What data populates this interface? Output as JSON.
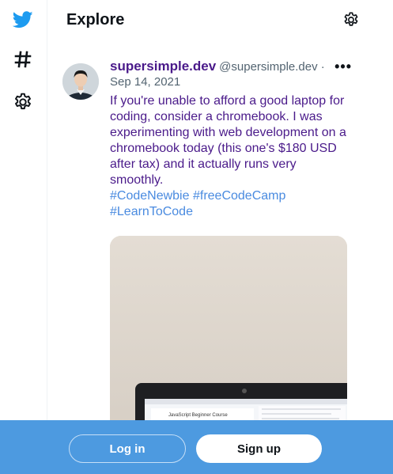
{
  "page": {
    "title": "Explore"
  },
  "nav": {
    "icons": [
      "twitter-logo-icon",
      "hashtag-icon",
      "gear-icon"
    ]
  },
  "tweet": {
    "author": "supersimple.dev",
    "handle": "@supersimple.dev ·",
    "date": "Sep 14, 2021",
    "text": "If you're unable to afford a good laptop for coding, consider a chromebook. I was experimenting with web development on a chromebook today (this one's $180 USD after tax) and it actually runs very smoothly.",
    "hashtags": [
      "#CodeNewbie",
      "#freeCodeCamp",
      "#LearnToCode"
    ],
    "more_icon": "•••",
    "screen_lines": [
      "JavaScript Beginner Course"
    ]
  },
  "footer": {
    "login_label": "Log in",
    "signup_label": "Sign up"
  },
  "colors": {
    "twitter_blue": "#1d9bf0",
    "footer_bg": "#4d9ae0",
    "tweet_text": "#4a1a8a",
    "hashtag": "#4a8be0"
  }
}
